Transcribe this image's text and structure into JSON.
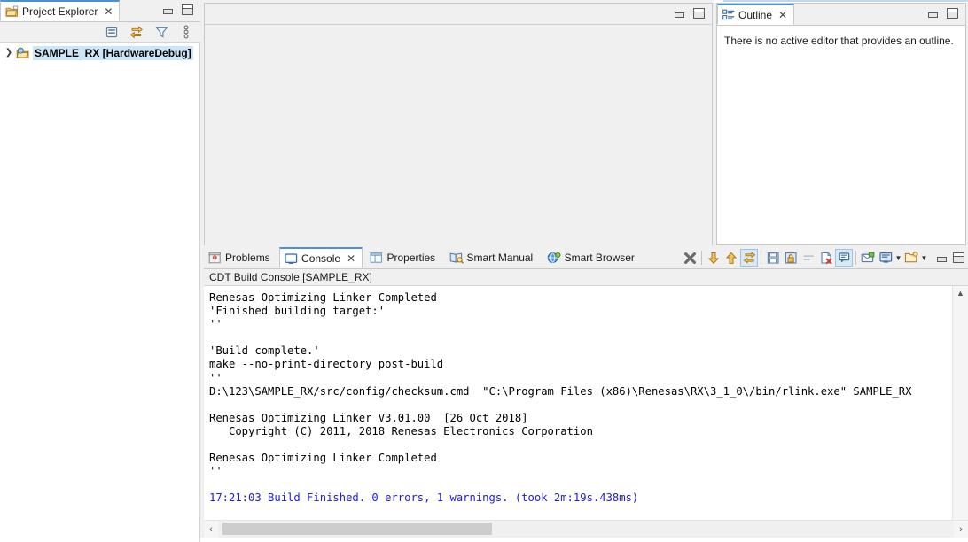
{
  "project_explorer": {
    "tab_label": "Project Explorer",
    "close_label": "✕",
    "toolbar": [
      {
        "name": "collapse-all-icon",
        "tooltip": "Collapse All"
      },
      {
        "name": "link-with-editor-icon",
        "tooltip": "Link with Editor"
      },
      {
        "name": "filter-icon",
        "tooltip": "View Menu Filters"
      },
      {
        "name": "view-menu-icon",
        "tooltip": "View Menu"
      }
    ],
    "tree": [
      {
        "expand_arrow": "❯",
        "label": "SAMPLE_RX [HardwareDebug]",
        "selected": true,
        "icon": "c-project-icon"
      }
    ]
  },
  "editor_area": {
    "tabs": [],
    "minimize_label": "Minimize",
    "maximize_label": "Maximize"
  },
  "outline": {
    "tab_label": "Outline",
    "close_label": "✕",
    "message": "There is no active editor that provides an outline.",
    "minimize_label": "Minimize",
    "maximize_label": "Maximize"
  },
  "console": {
    "tabs": [
      {
        "label": "Problems",
        "icon": "problems-icon",
        "active": false,
        "closable": false
      },
      {
        "label": "Console",
        "icon": "console-icon",
        "active": true,
        "closable": true
      },
      {
        "label": "Properties",
        "icon": "properties-icon",
        "active": false,
        "closable": false
      },
      {
        "label": "Smart Manual",
        "icon": "smart-manual-icon",
        "active": false,
        "closable": false
      },
      {
        "label": "Smart Browser",
        "icon": "smart-browser-icon",
        "active": false,
        "closable": false
      }
    ],
    "close_label": "✕",
    "toolbar": [
      {
        "name": "terminate-icon",
        "tooltip": "Terminate"
      },
      {
        "name": "scroll-down-icon",
        "tooltip": "Scroll Lock Down"
      },
      {
        "name": "scroll-up-icon",
        "tooltip": "Scroll Up"
      },
      {
        "name": "link-consoles-icon",
        "tooltip": "Pin Console",
        "active": true
      },
      {
        "name": "save-console-icon",
        "tooltip": "Save Console"
      },
      {
        "name": "lock-console-icon",
        "tooltip": "Lock Console"
      },
      {
        "name": "word-wrap-icon",
        "tooltip": "Word Wrap"
      },
      {
        "name": "clear-console-icon",
        "tooltip": "Clear Console"
      },
      {
        "name": "scroll-lock-icon",
        "tooltip": "Scroll Lock",
        "active": true
      },
      {
        "name": "pin-console-icon",
        "tooltip": "Pin Console"
      },
      {
        "name": "display-console-icon",
        "tooltip": "Display Selected Console"
      },
      {
        "name": "display-console-dropdown-icon",
        "tooltip": "Display Selected Console menu"
      },
      {
        "name": "open-console-icon",
        "tooltip": "Open Console"
      },
      {
        "name": "open-console-dropdown-icon",
        "tooltip": "Open Console menu"
      },
      {
        "name": "minimize-icon",
        "tooltip": "Minimize"
      },
      {
        "name": "maximize-icon",
        "tooltip": "Maximize"
      }
    ],
    "title": "CDT Build Console [SAMPLE_RX]",
    "lines": [
      {
        "text": "Renesas Optimizing Linker Completed",
        "color": "default"
      },
      {
        "text": "'Finished building target:'",
        "color": "default"
      },
      {
        "text": "''",
        "color": "default"
      },
      {
        "text": "",
        "color": "default"
      },
      {
        "text": "'Build complete.'",
        "color": "default"
      },
      {
        "text": "make --no-print-directory post-build",
        "color": "default"
      },
      {
        "text": "''",
        "color": "default"
      },
      {
        "text": "D:\\123\\SAMPLE_RX/src/config/checksum.cmd  \"C:\\Program Files (x86)\\Renesas\\RX\\3_1_0\\/bin/rlink.exe\" SAMPLE_RX",
        "color": "default"
      },
      {
        "text": "",
        "color": "default"
      },
      {
        "text": "Renesas Optimizing Linker V3.01.00  [26 Oct 2018]",
        "color": "default"
      },
      {
        "text": "   Copyright (C) 2011, 2018 Renesas Electronics Corporation",
        "color": "default"
      },
      {
        "text": "",
        "color": "default"
      },
      {
        "text": "Renesas Optimizing Linker Completed",
        "color": "default"
      },
      {
        "text": "''",
        "color": "default"
      },
      {
        "text": "",
        "color": "default"
      },
      {
        "text": "17:21:03 Build Finished. 0 errors, 1 warnings. (took 2m:19s.438ms)",
        "color": "blue"
      }
    ],
    "scroll_up_glyph": "▲",
    "scroll_down_glyph": "▼",
    "hscroll_left_glyph": "‹",
    "hscroll_right_glyph": "›"
  },
  "colors": {
    "accent_tab": "#4a90d9",
    "selection": "#cde6f7",
    "console_highlight_blue": "#2020d0",
    "panel_bg": "#f0f0f0",
    "toolbar_active": "#d7e9f7"
  }
}
